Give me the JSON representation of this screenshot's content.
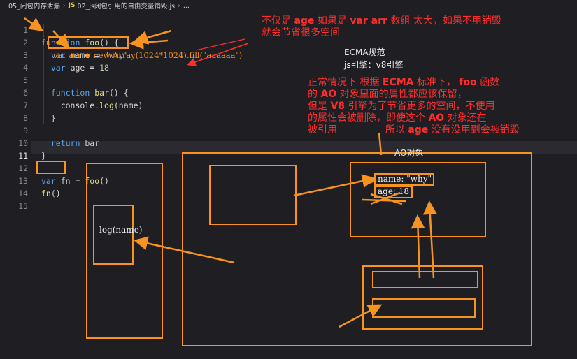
{
  "breadcrumb": {
    "folder": "05_闭包内存泄漏",
    "js_badge": "JS",
    "file": "02_js闭包引用的自由变量销毁.js",
    "ellipsis": "..."
  },
  "code_lines": [
    {
      "n": "1",
      "code": "function foo() {"
    },
    {
      "n": "2",
      "code": "  var name = \"why\""
    },
    {
      "n": "3",
      "code": "  var age = 18"
    },
    {
      "n": "4",
      "code": ""
    },
    {
      "n": "5",
      "code": "  function bar() {"
    },
    {
      "n": "6",
      "code": "    console.log(name)"
    },
    {
      "n": "7",
      "code": "  }"
    },
    {
      "n": "8",
      "code": ""
    },
    {
      "n": "9",
      "code": "  return bar"
    },
    {
      "n": "10",
      "code": "}"
    },
    {
      "n": "11",
      "code": ""
    },
    {
      "n": "12",
      "code": "var fn = foo()"
    },
    {
      "n": "13",
      "code": "fn()"
    },
    {
      "n": "14",
      "code": ""
    },
    {
      "n": "15",
      "code": ""
    }
  ],
  "annotations": {
    "inserted_code": "var arr = new Array(1024*1024).fill(\"aaaaaa\")",
    "red_top_line1_a": "不仅是",
    "red_top_line1_b": "age",
    "red_top_line1_c": "如果是",
    "red_top_line1_d": "var arr",
    "red_top_line1_e": "数组 太大，如果不用销毁",
    "red_top_line2": "就会节省很多空间",
    "ecma": "ECMA规范",
    "engine": "js引擎：v8引擎",
    "red_para_line1_a": "正常情况下 根据",
    "red_para_line1_b": "ECMA",
    "red_para_line1_c": "标准下，",
    "red_para_line1_d": "foo",
    "red_para_line1_e": "函数",
    "red_para_line2_a": "的",
    "red_para_line2_b": "AO",
    "red_para_line2_c": "对象里面的属性都应该保留，",
    "red_para_line3_a": "但是",
    "red_para_line3_b": "V8",
    "red_para_line3_c": "引擎为了节省更多的空间，不使用",
    "red_para_line4_a": "的属性会被删除，即使这个",
    "red_para_line4_b": "AO",
    "red_para_line4_c": "对象还在",
    "red_para_line5_a": "被引用",
    "red_para_line5_b": "所以",
    "red_para_line5_c": "age",
    "red_para_line5_d": "没有没用到会被销毁",
    "ao_label": "AO对象",
    "ao_name": "name: \"why\"",
    "ao_age": "age: 18",
    "bar_log": "log(name)"
  },
  "colors": {
    "accent_orange": "#f7931e",
    "annotation_red": "#ff2d2d",
    "background": "#1f1f23"
  }
}
